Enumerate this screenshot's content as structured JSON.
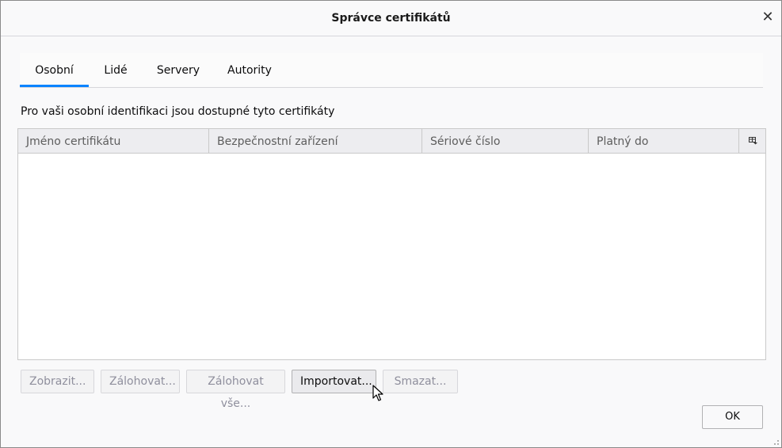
{
  "dialog": {
    "title": "Správce certifikátů",
    "close_glyph": "✕"
  },
  "tabs": [
    {
      "label": "Osobní",
      "active": true
    },
    {
      "label": "Lidé",
      "active": false
    },
    {
      "label": "Servery",
      "active": false
    },
    {
      "label": "Autority",
      "active": false
    }
  ],
  "panel": {
    "description": "Pro vaši osobní identifikaci jsou dostupné tyto certifikáty",
    "columns": [
      "Jméno certifikátu",
      "Bezpečnostní zařízení",
      "Sériové číslo",
      "Platný do"
    ],
    "rows": []
  },
  "buttons": {
    "view": "Zobrazit...",
    "backup": "Zálohovat...",
    "backup_all": "Zálohovat vše...",
    "import": "Importovat...",
    "delete": "Smazat...",
    "ok": "OK"
  },
  "icons": {
    "close": "close-icon",
    "column_picker": "column-picker-icon",
    "cursor": "mouse-cursor-icon"
  },
  "colors": {
    "accent": "#0a84ff"
  }
}
